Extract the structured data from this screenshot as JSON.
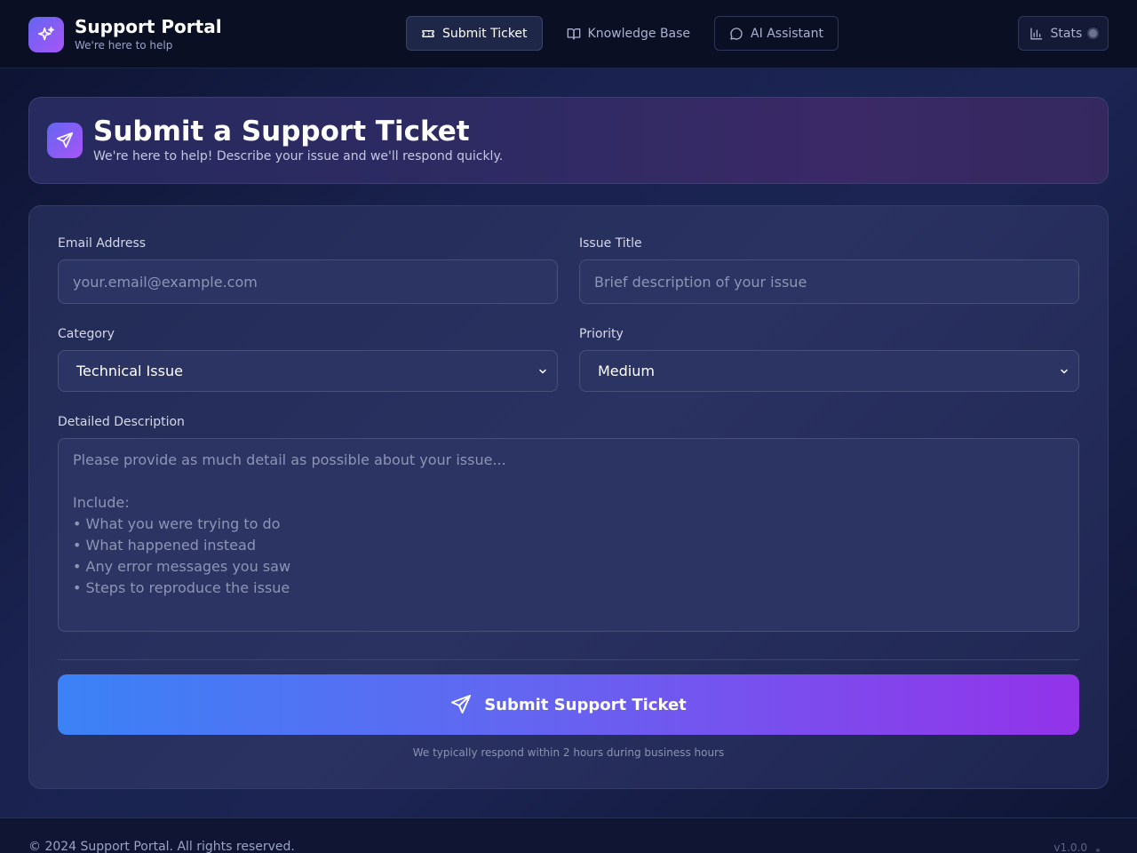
{
  "header": {
    "brand_title": "Support Portal",
    "brand_subtitle": "We're here to help",
    "nav": [
      {
        "label": "Submit Ticket",
        "icon": "ticket-icon",
        "active": true
      },
      {
        "label": "Knowledge Base",
        "icon": "book-icon",
        "active": false
      },
      {
        "label": "AI Assistant",
        "icon": "chat-icon",
        "active": false
      }
    ],
    "stats_label": "Stats"
  },
  "hero": {
    "title": "Submit a Support Ticket",
    "subtitle": "We're here to help! Describe your issue and we'll respond quickly."
  },
  "form": {
    "email": {
      "label": "Email Address",
      "placeholder": "your.email@example.com",
      "value": ""
    },
    "title": {
      "label": "Issue Title",
      "placeholder": "Brief description of your issue",
      "value": ""
    },
    "category": {
      "label": "Category",
      "value": "Technical Issue"
    },
    "priority": {
      "label": "Priority",
      "value": "Medium"
    },
    "description": {
      "label": "Detailed Description",
      "placeholder": "Please provide as much detail as possible about your issue...\n\nInclude:\n• What you were trying to do\n• What happened instead\n• Any error messages you saw\n• Steps to reproduce the issue",
      "value": ""
    },
    "submit_label": "Submit Support Ticket",
    "response_note": "We typically respond within 2 hours during business hours"
  },
  "footer": {
    "copyright": "© 2024 Support Portal. All rights reserved.",
    "version": "v1.0.0"
  },
  "colors": {
    "accent_start": "#3b82f6",
    "accent_mid": "#6366f1",
    "accent_end": "#9333ea"
  }
}
